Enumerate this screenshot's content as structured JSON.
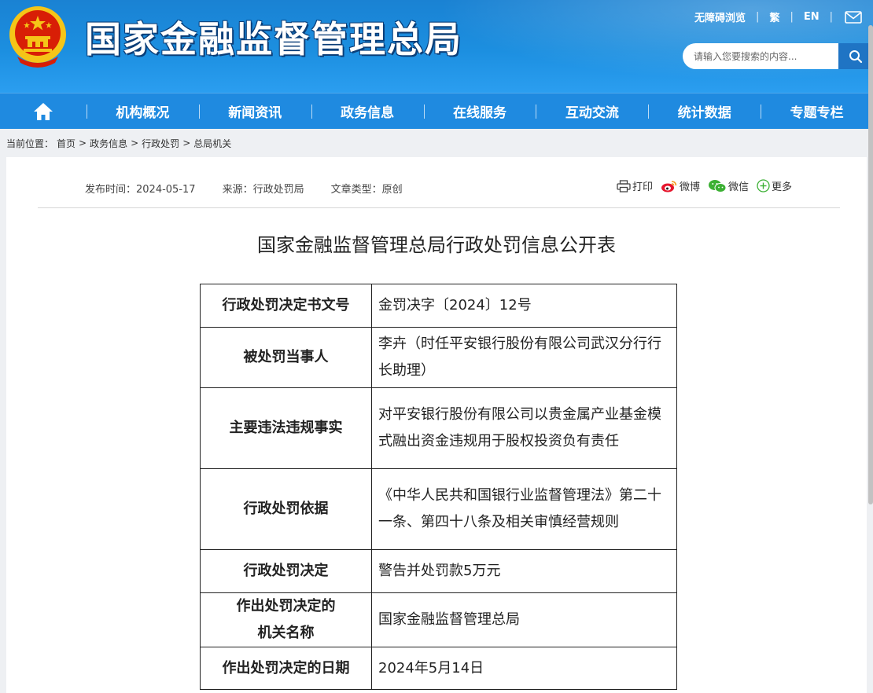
{
  "header": {
    "site_title": "国家金融监督管理总局",
    "links": {
      "accessibility": "无障碍浏览",
      "traditional": "繁",
      "english": "EN"
    },
    "search_placeholder": "请输入您要搜索的内容...",
    "icons": [
      "national-emblem-icon",
      "mail-icon",
      "search-icon"
    ]
  },
  "nav": {
    "home_icon": "home-icon",
    "items": [
      "机构概况",
      "新闻资讯",
      "政务信息",
      "在线服务",
      "互动交流",
      "统计数据",
      "专题专栏"
    ]
  },
  "breadcrumb": {
    "label": "当前位置：",
    "items": [
      "首页",
      "政务信息",
      "行政处罚",
      "总局机关"
    ],
    "separator": ">"
  },
  "article": {
    "publish_time": "发布时间：2024-05-17",
    "source": "来源：行政处罚局",
    "type": "文章类型：原创",
    "share": {
      "print": "打印",
      "weibo": "微博",
      "wechat": "微信",
      "more": "更多"
    },
    "title": "国家金融监督管理总局行政处罚信息公开表",
    "table": [
      {
        "key": "行政处罚决定书文号",
        "value": "金罚决字〔2024〕12号"
      },
      {
        "key": "被处罚当事人",
        "value": "李卉（时任平安银行股份有限公司武汉分行行长助理）"
      },
      {
        "key": "主要违法违规事实",
        "value": "对平安银行股份有限公司以贵金属产业基金模式融出资金违规用于股权投资负有责任"
      },
      {
        "key": "行政处罚依据",
        "value": "《中华人民共和国银行业监督管理法》第二十一条、第四十八条及相关审慎经营规则"
      },
      {
        "key": "行政处罚决定",
        "value": "警告并处罚款5万元"
      },
      {
        "key_line1": "作出处罚决定的",
        "key_line2": "机关名称",
        "value": "国家金融监督管理总局"
      },
      {
        "key": "作出处罚决定的日期",
        "value": "2024年5月14日"
      }
    ]
  },
  "colors": {
    "header_blue": "#1c8fe0",
    "nav_blue": "#1f8ae0",
    "emblem_red": "#d81e06",
    "emblem_gold": "#f5c518"
  }
}
